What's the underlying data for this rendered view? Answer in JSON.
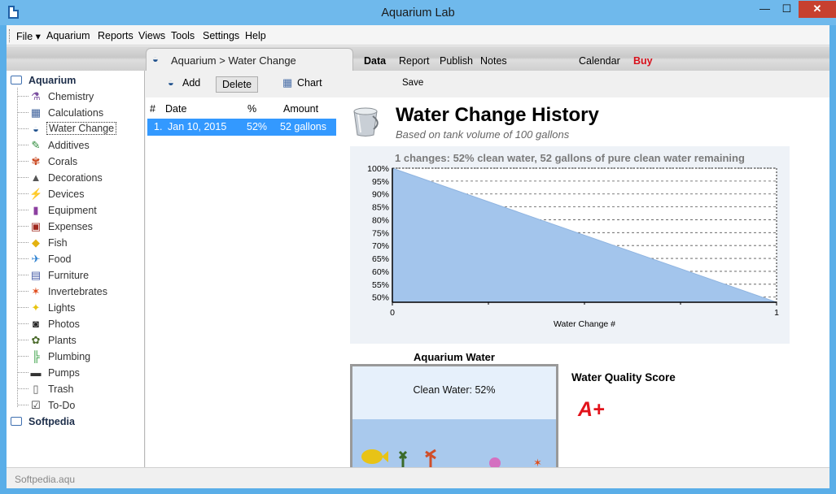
{
  "window": {
    "title": "Aquarium Lab",
    "min": "—",
    "max": "☐",
    "close": "✕"
  },
  "menu": [
    "File ▾",
    "Aquarium",
    "Reports",
    "Views",
    "Tools",
    "Settings",
    "Help"
  ],
  "tree": {
    "root1": "Aquarium",
    "items": [
      {
        "label": "Chemistry",
        "icon": "⚗",
        "color": "#7b4fa0"
      },
      {
        "label": "Calculations",
        "icon": "▦",
        "color": "#3b5f9a"
      },
      {
        "label": "Water Change",
        "icon": "◒",
        "color": "#1d4f8c"
      },
      {
        "label": "Additives",
        "icon": "✎",
        "color": "#2d8a3a"
      },
      {
        "label": "Corals",
        "icon": "✾",
        "color": "#c9461e"
      },
      {
        "label": "Decorations",
        "icon": "▲",
        "color": "#555555"
      },
      {
        "label": "Devices",
        "icon": "⚡",
        "color": "#d89a10"
      },
      {
        "label": "Equipment",
        "icon": "▮",
        "color": "#8c3fa0"
      },
      {
        "label": "Expenses",
        "icon": "▣",
        "color": "#a0281e"
      },
      {
        "label": "Fish",
        "icon": "◆",
        "color": "#e3b210"
      },
      {
        "label": "Food",
        "icon": "✈",
        "color": "#2a7fd0"
      },
      {
        "label": "Furniture",
        "icon": "▤",
        "color": "#4a5ea8"
      },
      {
        "label": "Invertebrates",
        "icon": "✶",
        "color": "#e04a1a"
      },
      {
        "label": "Lights",
        "icon": "✦",
        "color": "#e8c410"
      },
      {
        "label": "Photos",
        "icon": "◙",
        "color": "#222222"
      },
      {
        "label": "Plants",
        "icon": "✿",
        "color": "#4a6a2a"
      },
      {
        "label": "Plumbing",
        "icon": "╠",
        "color": "#2e9a3a"
      },
      {
        "label": "Pumps",
        "icon": "▬",
        "color": "#333333"
      },
      {
        "label": "Trash",
        "icon": "▯",
        "color": "#555555"
      },
      {
        "label": "To-Do",
        "icon": "☑",
        "color": "#333333"
      }
    ],
    "root2": "Softpedia"
  },
  "breadcrumb": "Aquarium > Water Change",
  "tabs": {
    "data": "Data",
    "report": "Report",
    "publish": "Publish",
    "notes": "Notes",
    "calendar": "Calendar",
    "buy": "Buy"
  },
  "actions": {
    "add": "Add",
    "delete": "Delete",
    "chart": "Chart",
    "save": "Save"
  },
  "list": {
    "headers": {
      "num": "#",
      "date": "Date",
      "pct": "%",
      "amount": "Amount"
    },
    "rows": [
      {
        "num": "1.",
        "date": "Jan 10, 2015",
        "pct": "52%",
        "amount": "52 gallons"
      }
    ]
  },
  "report": {
    "title": "Water Change History",
    "subtitle": "Based on tank volume of 100 gallons",
    "water_title": "Aquarium Water",
    "clean_label": "Clean Water: 52%",
    "quality_title": "Water Quality Score",
    "grade": "A+"
  },
  "chart_data": {
    "type": "area",
    "title": "1 changes: 52% clean water, 52 gallons of pure clean water remaining",
    "xlabel": "Water Change #",
    "ylabel": "",
    "x": [
      0,
      1
    ],
    "values": [
      100,
      48
    ],
    "xlim": [
      0,
      1
    ],
    "ylim": [
      48,
      100
    ],
    "yticks": [
      "100%",
      "95%",
      "90%",
      "85%",
      "80%",
      "75%",
      "70%",
      "65%",
      "60%",
      "55%",
      "50%"
    ],
    "ytick_values": [
      100,
      95,
      90,
      85,
      80,
      75,
      70,
      65,
      60,
      55,
      50
    ],
    "xticks": [
      "0",
      "1"
    ],
    "fill_color": "#a3c5ec",
    "grid": true
  },
  "status": {
    "file": "Softpedia.aqu"
  }
}
